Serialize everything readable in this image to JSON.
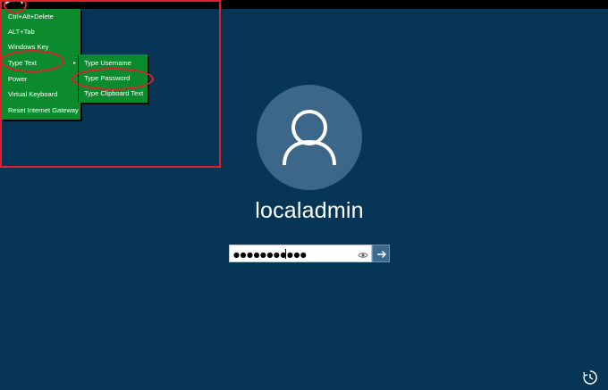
{
  "topbar": {
    "toggle_icon": "keyboard-shortcut-toggle-icon",
    "toggle_glyph_a": "▸",
    "toggle_glyph_b": "▾"
  },
  "menu": {
    "background": "#0b8a2e",
    "items": [
      {
        "label": "Ctrl+Alt+Delete"
      },
      {
        "label": "ALT+Tab"
      },
      {
        "label": "Windows Key"
      },
      {
        "label": "Type Text",
        "has_submenu": true
      },
      {
        "label": "Power"
      },
      {
        "label": "Virtual Keyboard"
      },
      {
        "label": "Reset Internet Gateway"
      }
    ],
    "submenu_arrow": "▸"
  },
  "submenu": {
    "items": [
      {
        "label": "Type Username"
      },
      {
        "label": "Type Password"
      },
      {
        "label": "Type Clipboard Text"
      }
    ]
  },
  "highlight_color": "#e0202a",
  "login": {
    "background": "#073555",
    "avatar_icon": "user-avatar-icon",
    "username": "localadmin",
    "password_value": "●●●●●●●●●●●",
    "reveal_icon": "eye-icon",
    "submit_icon": "arrow-right-icon"
  },
  "ease_of_access_icon": "ease-of-access-icon"
}
